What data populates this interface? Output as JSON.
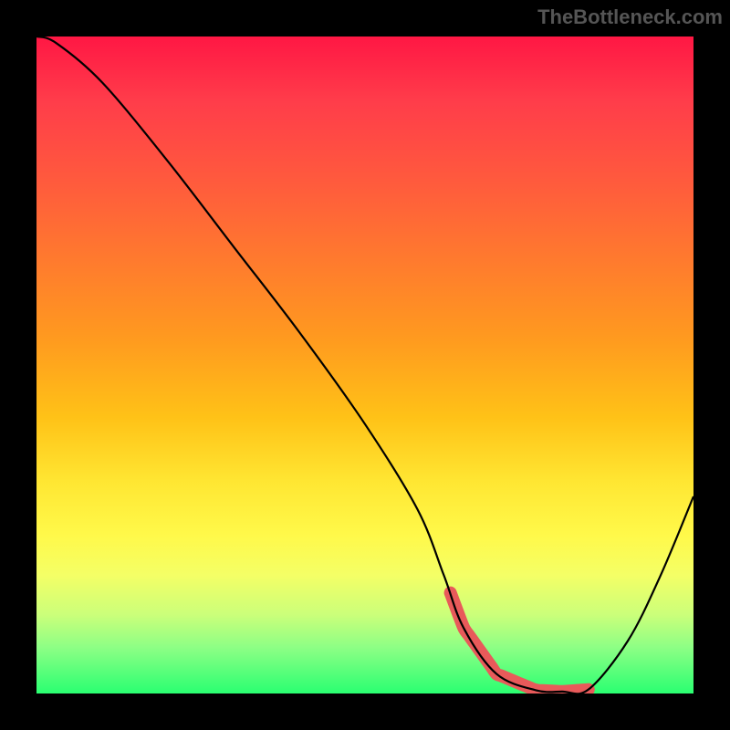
{
  "watermark": "TheBottleneck.com",
  "chart_data": {
    "type": "line",
    "title": "",
    "xlabel": "",
    "ylabel": "",
    "xlim": [
      0,
      100
    ],
    "ylim": [
      0,
      100
    ],
    "grid": false,
    "series": [
      {
        "name": "bottleneck-curve",
        "x": [
          0,
          3,
          10,
          20,
          30,
          40,
          50,
          58,
          62,
          65,
          70,
          76,
          80,
          84,
          90,
          95,
          100
        ],
        "y": [
          100,
          99,
          93,
          81,
          68,
          55,
          41,
          28,
          18,
          10,
          3,
          0.5,
          0.3,
          0.6,
          8,
          18,
          30
        ]
      }
    ],
    "highlight_range_x": [
      63,
      84
    ],
    "background": "rainbow-gradient",
    "description": "V-shaped curve over vertical heat gradient (red at top → green at bottom). Minimum around x≈78. Pink thick segment marks the low-bottleneck zone roughly x∈[63,84]."
  }
}
